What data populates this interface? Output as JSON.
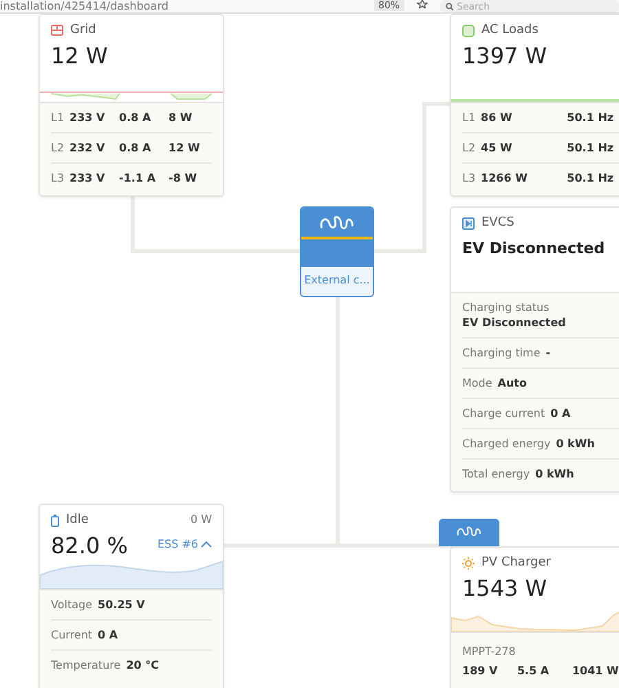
{
  "browser": {
    "address": "installation/425414/dashboard",
    "zoom": "80%",
    "search": {
      "placeholder": "Search"
    }
  },
  "grid": {
    "title": "Grid",
    "value": "12 W",
    "phases": [
      {
        "phase": "L1",
        "voltage": "233 V",
        "current": "0.8 A",
        "power": "8 W"
      },
      {
        "phase": "L2",
        "voltage": "232 V",
        "current": "0.8 A",
        "power": "12 W"
      },
      {
        "phase": "L3",
        "voltage": "233 V",
        "current": "-1.1 A",
        "power": "-8 W"
      }
    ]
  },
  "ac_loads": {
    "title": "AC Loads",
    "value": "1397 W",
    "phases": [
      {
        "phase": "L1",
        "power": "86 W",
        "frequency": "50.1 Hz"
      },
      {
        "phase": "L2",
        "power": "45 W",
        "frequency": "50.1 Hz"
      },
      {
        "phase": "L3",
        "power": "1266 W",
        "frequency": "50.1 Hz"
      }
    ]
  },
  "inverter": {
    "label": "External c..."
  },
  "evcs": {
    "title": "EVCS",
    "value": "EV Disconnected",
    "rows": [
      {
        "label": "Charging status",
        "value": "EV Disconnected",
        "kind": "stacked"
      },
      {
        "label": "Charging time",
        "value": "-",
        "kind": "inline"
      },
      {
        "label": "Mode",
        "value": "Auto",
        "kind": "inline"
      },
      {
        "label": "Charge current",
        "value": "0 A",
        "kind": "inline"
      },
      {
        "label": "Charged energy",
        "value": "0 kWh",
        "kind": "inline"
      },
      {
        "label": "Total energy",
        "value": "0 kWh",
        "kind": "inline"
      }
    ]
  },
  "battery": {
    "title": "Idle",
    "power": "0 W",
    "value": "82.0 %",
    "system": "ESS #6",
    "expanded": true,
    "rows": [
      {
        "label": "Voltage",
        "value": "50.25 V"
      },
      {
        "label": "Current",
        "value": "0 A"
      },
      {
        "label": "Temperature",
        "value": "20 °C"
      }
    ]
  },
  "pv_charger": {
    "title": "PV Charger",
    "value": "1543 W",
    "device": "MPPT-278",
    "voltage": "189 V",
    "current": "5.5 A",
    "power": "1041 W"
  }
}
